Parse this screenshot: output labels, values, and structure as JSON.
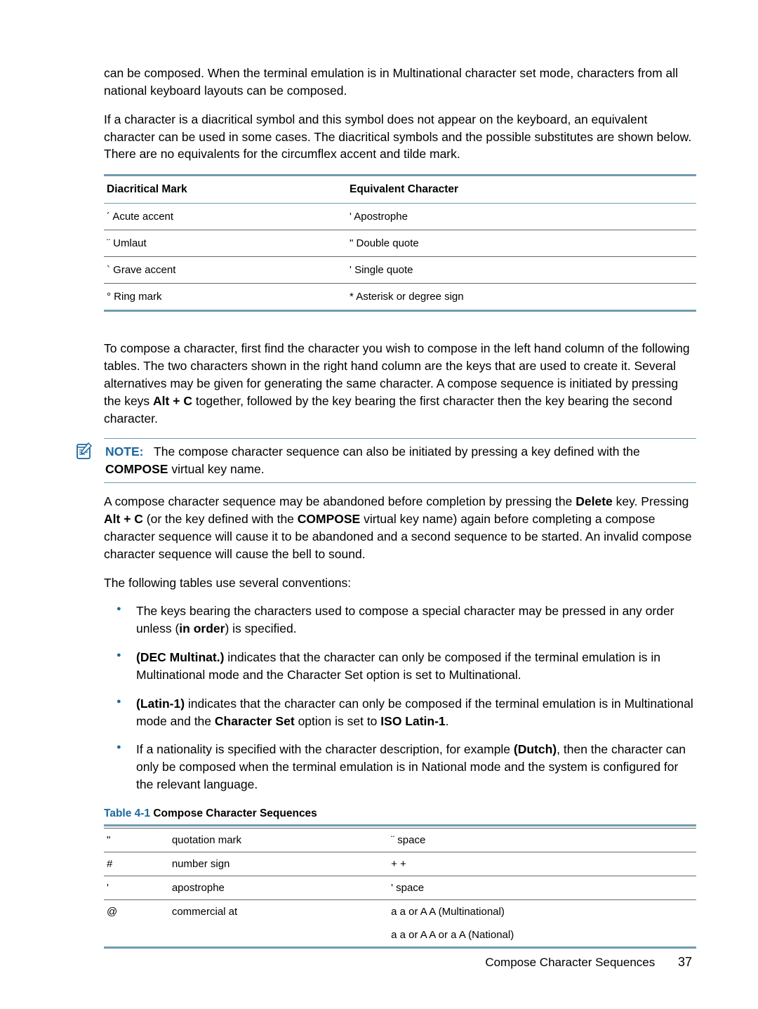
{
  "intro": {
    "p1": "can be composed. When the terminal emulation is in Multinational character set mode, characters from all national keyboard layouts can be composed.",
    "p2": "If a character is a diacritical symbol and this symbol does not appear on the keyboard, an equivalent character can be used in some cases. The diacritical symbols and the possible substitutes are shown below. There are no equivalents for the circumflex accent and tilde mark."
  },
  "table1": {
    "h1": "Diacritical Mark",
    "h2": "Equivalent Character",
    "rows": [
      {
        "mark": "´ Acute accent",
        "equiv": "' Apostrophe"
      },
      {
        "mark": "¨ Umlaut",
        "equiv": "\" Double quote"
      },
      {
        "mark": "` Grave accent",
        "equiv": "' Single quote"
      },
      {
        "mark": "° Ring mark",
        "equiv": "* Asterisk or degree sign"
      }
    ]
  },
  "mid": {
    "p1a": "To compose a character, first find the character you wish to compose in the left hand column of the following tables. The two characters shown in the right hand column are the keys that are used to create it. Several alternatives may be given for generating the same character. A compose sequence is initiated by pressing the keys ",
    "p1b": "Alt + C",
    "p1c": " together, followed by the key bearing the first character then the key bearing the second character."
  },
  "note": {
    "label": "NOTE:",
    "a": "The compose character sequence can also be initiated by pressing a key defined with the ",
    "b": "COMPOSE",
    "c": " virtual key name."
  },
  "after": {
    "p1a": "A compose character sequence may be abandoned before completion by pressing the ",
    "p1b": "Delete",
    "p1c": " key. Pressing ",
    "p1d": "Alt + C",
    "p1e": " (or the key defined with the ",
    "p1f": "COMPOSE",
    "p1g": " virtual key name) again before completing a compose character sequence will cause it to be abandoned and a second sequence to be started. An invalid compose character sequence will cause the bell to sound.",
    "p2": "The following tables use several conventions:"
  },
  "bullets": {
    "b1a": "The keys bearing the characters used to compose a special character may be pressed in any order unless (",
    "b1b": "in order",
    "b1c": ") is specified.",
    "b2a": "(DEC Multinat.)",
    "b2b": " indicates that the character can only be composed if the terminal emulation is in Multinational mode and the Character Set option is set to Multinational.",
    "b3a": "(Latin-1)",
    "b3b": " indicates that the character can only be composed if the terminal emulation is in Multinational mode and the ",
    "b3c": "Character Set",
    "b3d": " option is set to ",
    "b3e": "ISO Latin-1",
    "b3f": ".",
    "b4a": "If a nationality is specified with the character description, for example ",
    "b4b": "(Dutch)",
    "b4c": ", then the character can only be composed when the terminal emulation is in National mode and the system is configured for the relevant language."
  },
  "caption": {
    "num": "Table 4-1",
    "title": "  Compose Character Sequences"
  },
  "table2": {
    "rows": [
      {
        "sym": "\"",
        "name": "quotation mark",
        "seq": "¨ space"
      },
      {
        "sym": "#",
        "name": "number sign",
        "seq": "+ +"
      },
      {
        "sym": "'",
        "name": "apostrophe",
        "seq": "' space"
      },
      {
        "sym": "@",
        "name": "commercial at",
        "seq": "a a or A A (Multinational)"
      },
      {
        "sym": "",
        "name": "",
        "seq": "a a or A A or a A (National)"
      }
    ]
  },
  "footer": {
    "section": "Compose Character Sequences",
    "page": "37"
  }
}
